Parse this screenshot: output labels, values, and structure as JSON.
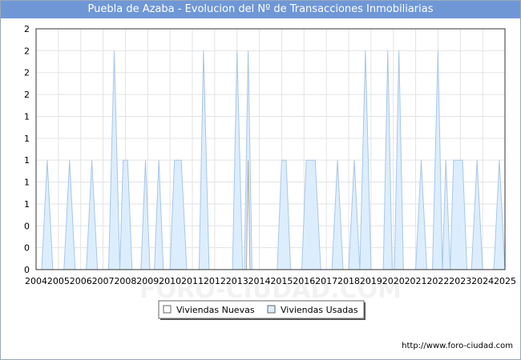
{
  "chart_data": {
    "type": "area",
    "title": "Puebla de Azaba - Evolucion del Nº de Transacciones Inmobiliarias",
    "xlabel": "",
    "ylabel": "",
    "x_range": [
      2004,
      2025
    ],
    "x_ticks": [
      "2004",
      "2005",
      "2006",
      "2007",
      "2008",
      "2009",
      "2010",
      "2011",
      "2012",
      "2013",
      "2014",
      "2015",
      "2016",
      "2017",
      "2018",
      "2019",
      "2020",
      "2021",
      "2022",
      "2023",
      "2024",
      "2025"
    ],
    "y_range": [
      0,
      2.2
    ],
    "y_tick_values": [
      0,
      0.2,
      0.4,
      0.6,
      0.8,
      1.0,
      1.2,
      1.4,
      1.6,
      1.8,
      2.0,
      2.2
    ],
    "y_tick_labels": [
      "0",
      "0",
      "0",
      "1",
      "1",
      "1",
      "1",
      "1",
      "2",
      "2",
      "2",
      "2"
    ],
    "grid": true,
    "legend": "bottom-center",
    "series": [
      {
        "name": "Viviendas Nuevas",
        "color": "#aaaaaa",
        "fill": "#ffffff",
        "points": [
          [
            2013.42,
            0
          ],
          [
            2013.5,
            1
          ],
          [
            2013.58,
            0
          ]
        ]
      },
      {
        "name": "Viviendas Usadas",
        "color": "#a9c6e8",
        "fill": "#dceefd",
        "points": [
          [
            2004.0,
            0
          ],
          [
            2004.25,
            0
          ],
          [
            2004.5,
            1
          ],
          [
            2004.75,
            0
          ],
          [
            2005.25,
            0
          ],
          [
            2005.5,
            1
          ],
          [
            2005.75,
            0
          ],
          [
            2006.25,
            0
          ],
          [
            2006.5,
            1
          ],
          [
            2006.75,
            0
          ],
          [
            2007.25,
            0
          ],
          [
            2007.5,
            2
          ],
          [
            2007.75,
            0
          ],
          [
            2007.9,
            1
          ],
          [
            2008.1,
            1
          ],
          [
            2008.3,
            0
          ],
          [
            2008.7,
            0
          ],
          [
            2008.9,
            1
          ],
          [
            2009.1,
            0
          ],
          [
            2009.3,
            0
          ],
          [
            2009.5,
            1
          ],
          [
            2009.7,
            0
          ],
          [
            2010.0,
            0
          ],
          [
            2010.2,
            1
          ],
          [
            2010.5,
            1
          ],
          [
            2010.75,
            0
          ],
          [
            2011.3,
            0
          ],
          [
            2011.5,
            2
          ],
          [
            2011.75,
            0
          ],
          [
            2012.8,
            0
          ],
          [
            2013.0,
            2
          ],
          [
            2013.25,
            0
          ],
          [
            2013.33,
            0
          ],
          [
            2013.5,
            2
          ],
          [
            2013.67,
            0
          ],
          [
            2014.8,
            0
          ],
          [
            2015.0,
            1
          ],
          [
            2015.2,
            1
          ],
          [
            2015.4,
            0
          ],
          [
            2015.9,
            0
          ],
          [
            2016.1,
            1
          ],
          [
            2016.5,
            1
          ],
          [
            2016.75,
            0
          ],
          [
            2017.25,
            0
          ],
          [
            2017.5,
            1
          ],
          [
            2017.75,
            0
          ],
          [
            2018.0,
            0
          ],
          [
            2018.25,
            1
          ],
          [
            2018.5,
            0
          ],
          [
            2018.75,
            2
          ],
          [
            2019.0,
            0
          ],
          [
            2019.55,
            0
          ],
          [
            2019.75,
            2
          ],
          [
            2019.95,
            0
          ],
          [
            2020.05,
            0
          ],
          [
            2020.25,
            2
          ],
          [
            2020.45,
            0
          ],
          [
            2021.0,
            0
          ],
          [
            2021.25,
            1
          ],
          [
            2021.5,
            0
          ],
          [
            2021.75,
            0
          ],
          [
            2022.0,
            2
          ],
          [
            2022.2,
            0
          ],
          [
            2022.35,
            1
          ],
          [
            2022.55,
            0
          ],
          [
            2022.7,
            1
          ],
          [
            2023.1,
            1
          ],
          [
            2023.3,
            0
          ],
          [
            2023.5,
            0
          ],
          [
            2023.75,
            1
          ],
          [
            2024.0,
            0
          ],
          [
            2024.5,
            0
          ],
          [
            2024.75,
            1
          ],
          [
            2025.0,
            0
          ]
        ]
      }
    ],
    "source": "http://www.foro-ciudad.com",
    "watermark": "FORO-CIUDAD.COM"
  }
}
